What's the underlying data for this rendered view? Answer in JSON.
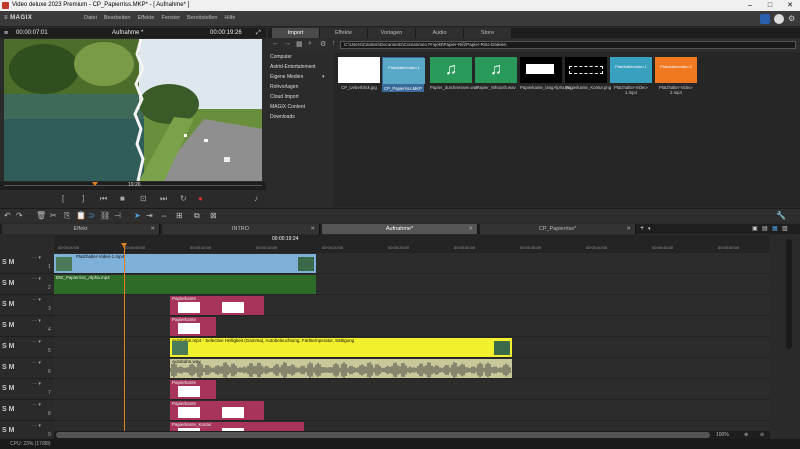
{
  "window": {
    "title": "Video deluxe 2023 Premium - CP_Papierriss.MKP* - [ Aufnahme* ]"
  },
  "menubar": {
    "logo": "≡ MAGIX",
    "items": [
      "Datei",
      "Bearbeiten",
      "Effekte",
      "Fenster",
      "Bereitstellen",
      "Hilfe"
    ]
  },
  "preview": {
    "timecode_left": "00:00:07:01",
    "title": "Aufnahme *",
    "timecode_right": "00:00:19:26",
    "scrub_label": "19:26"
  },
  "media": {
    "tabs": [
      "Import",
      "Effekte",
      "Vorlagen",
      "Audio",
      "Store"
    ],
    "active_tab": "Import",
    "path": "C:\\Users\\Carsten\\Documents\\Comanmeo Projekt\\Papier-Riß\\Papier-Riss-Dateien",
    "sidebar": [
      "Computer",
      "Astrid-Entertainment",
      "Eigene Medien",
      "Rohvorlagen",
      "Cloud Import",
      "MAGIX Content",
      "Downloads"
    ],
    "sidebar_arrow": "▾",
    "tiles": [
      {
        "label": "CP_Ueberblick.jpg",
        "thumb_text": ""
      },
      {
        "label": "CP_Papierriss.MKP",
        "thumb_text": "Platzhaltervideo 1"
      },
      {
        "label": "Papier_durchreissen.wav",
        "thumb_text": ""
      },
      {
        "label": "Papier_Whoosh.wav",
        "thumb_text": ""
      },
      {
        "label": "Papierkante_langAlpha.png",
        "thumb_text": ""
      },
      {
        "label": "Papierkante_Kontur.png",
        "thumb_text": ""
      },
      {
        "label": "Platzhalter-Video-1.mp4",
        "thumb_text": "Platzhaltervideo 1"
      },
      {
        "label": "Platzhalter-Video-2.mp4",
        "thumb_text": "Platzhaltervideo 2"
      }
    ]
  },
  "project_tabs": [
    {
      "label": "Effekt"
    },
    {
      "label": "INTRO"
    },
    {
      "label": "Aufnahme*"
    },
    {
      "label": "CP_Papierriss*"
    }
  ],
  "project_tab_close": "✕",
  "timeline": {
    "current_timecode": "00:00:19:24",
    "ruler_ticks": [
      "00:00:00:00",
      "00:00:05:00",
      "00:00:10:00",
      "00:00:15:00",
      "00:00:20:00",
      "00:00:25:00",
      "00:00:30:00",
      "00:00:35:00",
      "00:00:40:00",
      "00:00:45:00",
      "00:00:50:00"
    ],
    "track_label": "S M",
    "tracks": [
      "1",
      "2",
      "3",
      "4",
      "5",
      "6",
      "7",
      "8",
      "9"
    ],
    "clips": [
      {
        "name": "Platzhalter-Video-1.mp4"
      },
      {
        "name": "BW_Papierriss_Alpha.mp4"
      },
      {
        "name": "Papierkante"
      },
      {
        "name": "Papierkante"
      },
      {
        "name": "Autobahn.mp4 - Selective Helligkeit (Gamma), Autobeleuchtung, Farbtemperatur, Sättigung"
      },
      {
        "name": "Autobahn.wav"
      },
      {
        "name": "Papierkante"
      },
      {
        "name": "Papierkante"
      },
      {
        "name": "Papierkante_Kontur"
      }
    ]
  },
  "zoom": "100%",
  "status": "CPU: 23% (17/88)",
  "colors": {
    "accent": "#e08020",
    "video_clip": "#7fb0d8",
    "green_clip": "#2e6a28",
    "pink_clip": "#a8345c",
    "yellow_clip": "#f2f02c"
  }
}
